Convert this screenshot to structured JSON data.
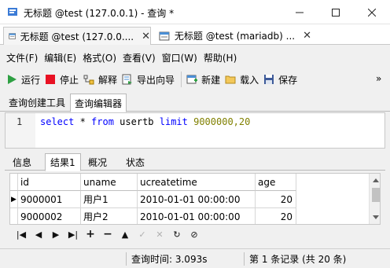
{
  "window": {
    "title": "无标题 @test (127.0.0.1) - 查询 *",
    "controls": [
      "minimize",
      "maximize",
      "close"
    ]
  },
  "doc_tabs": [
    {
      "label": "无标题 @test (127.0.0....",
      "icon": "query-icon",
      "active": true
    },
    {
      "label": "无标题 @test (mariadb) ...",
      "icon": "query-icon",
      "active": false
    }
  ],
  "menu": [
    "文件(F)",
    "编辑(E)",
    "格式(O)",
    "查看(V)",
    "窗口(W)",
    "帮助(H)"
  ],
  "toolbar": {
    "run": "运行",
    "stop": "停止",
    "explain": "解释",
    "export": "导出向导",
    "new": "新建",
    "load": "载入",
    "save": "保存",
    "overflow": "»"
  },
  "query_tabs": [
    "查询创建工具",
    "查询编辑器"
  ],
  "editor": {
    "line_number": "1",
    "tokens": [
      {
        "text": "select",
        "kind": "kw"
      },
      {
        "text": " * ",
        "kind": "plain"
      },
      {
        "text": "from",
        "kind": "kw"
      },
      {
        "text": " usertb ",
        "kind": "plain"
      },
      {
        "text": "limit",
        "kind": "kw"
      },
      {
        "text": " 9000000,20",
        "kind": "num"
      }
    ]
  },
  "result_tabs": [
    "信息",
    "结果1",
    "概况",
    "状态"
  ],
  "grid": {
    "columns": [
      "id",
      "uname",
      "ucreatetime",
      "age"
    ],
    "rows": [
      [
        "9000001",
        "用户1",
        "2010-01-01 00:00:00",
        "20"
      ],
      [
        "9000002",
        "用户2",
        "2010-01-01 00:00:00",
        "20"
      ]
    ]
  },
  "nav_buttons": [
    "first-record-icon",
    "prev-record-icon",
    "next-record-icon",
    "last-record-icon",
    "add-record-icon",
    "delete-record-icon",
    "move-up-icon",
    "apply-icon",
    "discard-icon",
    "refresh-icon",
    "stop-icon"
  ],
  "status": {
    "query_time": "查询时间: 3.093s",
    "record": "第 1 条记录 (共 20 条)"
  },
  "colors": {
    "keyword": "#0000ff",
    "number": "#808000",
    "run": "#2ea043",
    "stop": "#e81123"
  }
}
